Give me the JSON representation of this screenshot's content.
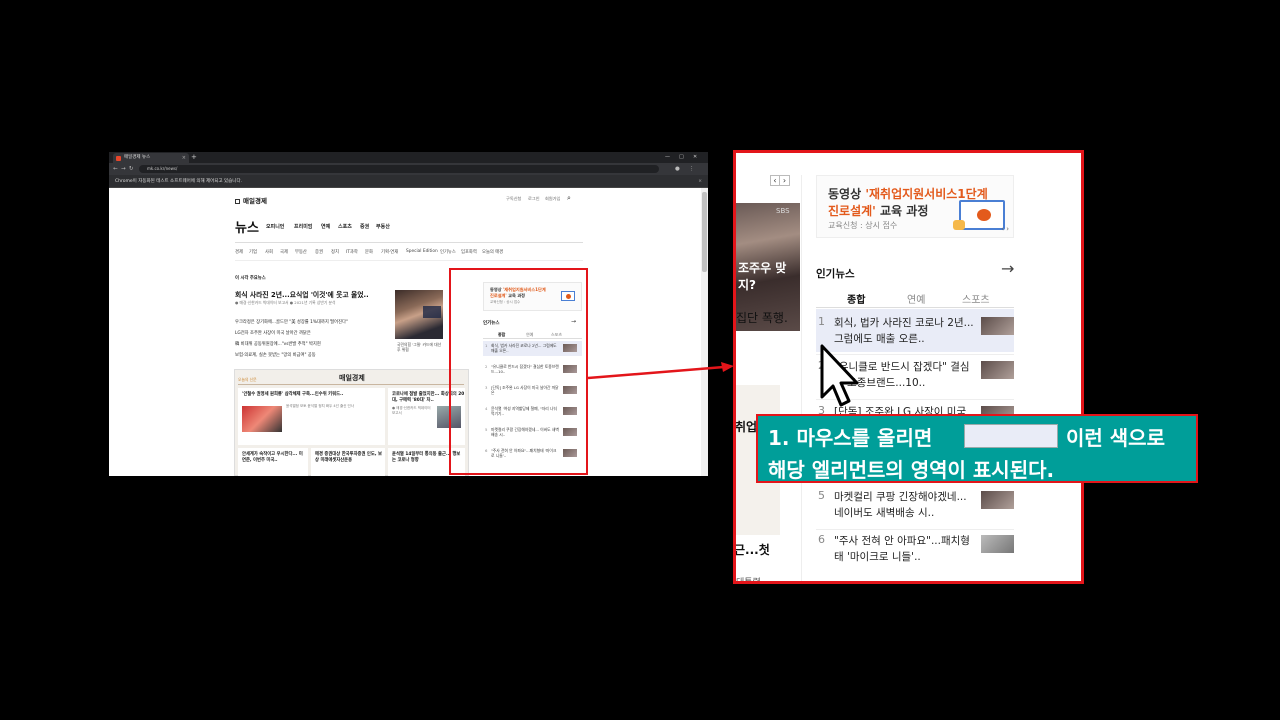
{
  "browser": {
    "tab_title": "매일경제 뉴스",
    "url": "mk.co.kr/news/",
    "infobar_text": "Chrome이 자동화된 테스트 소프트웨어에 의해 제어되고 있습니다.",
    "site": {
      "logo": "매일경제",
      "util_links": [
        "구독신청",
        "로그인",
        "회원가입"
      ],
      "section_title": "뉴스",
      "main_menu": [
        "오피니언",
        "프리미엄",
        "연예",
        "스포츠",
        "증권",
        "부동산"
      ],
      "sub_menu": [
        "경제",
        "기업",
        "사회",
        "국제",
        "부동산",
        "증권",
        "정치",
        "IT과학",
        "문화",
        "기획·연재",
        "Special Edition",
        "인기뉴스",
        "임포화력",
        "오늘의 매경"
      ],
      "kicker": "이 시각 주요뉴스",
      "headline": "회식 사라진 2년...요식업 '이것'에 웃고 울었..",
      "headline_sub": "● 매경·신한카드 빅데이터 보고서 ● 2021년 기록 상반기 분석",
      "sub_headlines": [
        "우크라정은 장기화에...골드만 \"美 성장률 1%대까지 떨어진다\"",
        "LG전자 조주완 사장이 미국 날아간 까닭은",
        "韓 비대위 공동위원장에...\"vs반발 추적\" 박지현",
        "보험·의료계, 실손 못받는 \"망의 비급여\" 공동"
      ],
      "photo_caption": "국민의힘 '그릴' 카드에 대선 후 위협",
      "box_tag": "오늘의 신문",
      "box_title": "매일경제",
      "box_cards": [
        {
          "title": "'안철수 권영세 원희룡' 삼각체제 구축...인수위 키워드..",
          "desc": "윤석열정 모토 윤석열 정치 화두 4선 출신 인사"
        },
        {
          "title": "코로나에 점발 줄었지만... 화상회의 20대, 구매력 '80대' 차..",
          "desc": "● 매경·신한카드 빅데이터 보고서"
        },
        {
          "title": "안세계가 숙작이고 우시한다... 미 연준, 이번주 미국..",
          "desc": "외국 정당보고 인사"
        },
        {
          "title": "매경 증권대상 한국투자증권 인도, 보상 미래에셋자산운용",
          "desc": ""
        },
        {
          "title": "윤석열 14일부터 통의동 출근... 행보는 코로나 형향",
          "desc": ""
        }
      ],
      "ad": {
        "line1_prefix": "동영상 ",
        "line1_highlight": "'재취업지원서비스1단계",
        "line2_highlight": "진로설계'",
        "line2_suffix": " 교육 과정",
        "sub": "교육신청 : 상시 접수"
      },
      "popular_title": "인기뉴스",
      "popular_tabs": [
        "종합",
        "연예",
        "스포츠"
      ],
      "popular_items": [
        "회식, 법카 사라진 코로나 2년... 그럼에도 매출 오른..",
        "\"유니클로 반드시 잡겠다\" 결심한 토종브랜드...10..",
        "[단독] 조주완 LG 사장이 미국 날아간 까닭은",
        "윤석열 '여성 지역할당제 철폐, \"자리 나눠먹기기..",
        "마켓컬리 쿠팡 긴장해야겠네... 이버도 새벽배송 시..",
        "\"주사 전혀 안 아파요\"...패치형태 '마이크로 니들'.."
      ]
    }
  },
  "zoom": {
    "ad": {
      "line1_prefix": "동영상 ",
      "line1_highlight": "'재취업지원서비스1단계",
      "line2_highlight": "진로설계'",
      "line2_suffix": " 교육 과정",
      "sub": "교육신청 : 상시 접수"
    },
    "popular_title": "인기뉴스",
    "tabs": [
      "종합",
      "연예",
      "스포츠"
    ],
    "items": [
      {
        "num": "1",
        "title": "회식, 법카 사라진 코로나 2년... 그럼에도 매출 오른.."
      },
      {
        "num": "2",
        "title": "\"유니클로 반드시 잡겠다\" 결심한 토종브랜드...10.."
      },
      {
        "num": "3",
        "title": "[단독] 조주완 LG 사장이 미국 날"
      },
      {
        "num": "5",
        "title": "마켓컬리 쿠팡 긴장해야겠네...네이버도 새벽배송 시.."
      },
      {
        "num": "6",
        "title": "\"주사 전혀 안 아파요\"...패치형태 '마이크로 니들'.."
      }
    ],
    "left_fragments": [
      "SBS",
      "조주우 맞지?",
      "집단 폭행.",
      "취업",
      "근...첫",
      "대통령"
    ]
  },
  "callout": {
    "line1_before": "1. 마우스를 올리면",
    "line1_after": "이런 색으로",
    "line2": "해당 엘리먼트의 영역이 표시된다."
  },
  "colors": {
    "highlight": "#e9ecf7",
    "frame_red": "#e3151a",
    "callout_bg": "#009e99",
    "ad_orange": "#e35a1c"
  }
}
